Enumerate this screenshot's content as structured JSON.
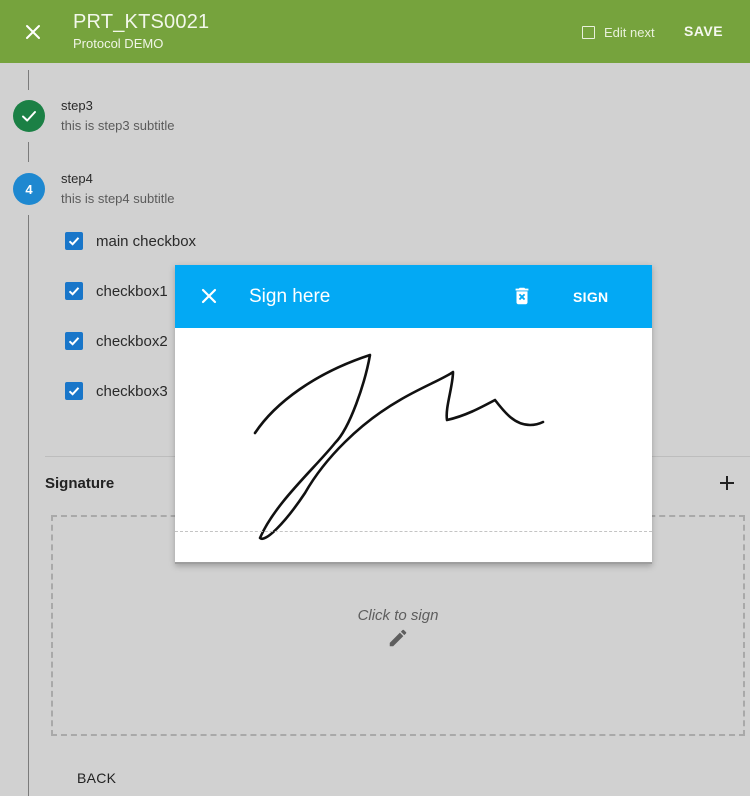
{
  "header": {
    "title": "PRT_KTS0021",
    "subtitle": "Protocol DEMO",
    "edit_next_label": "Edit next",
    "save_label": "SAVE",
    "bg_color": "#76a33d"
  },
  "steps": [
    {
      "title": "step3",
      "subtitle": "this is step3 subtitle",
      "status": "done",
      "icon": "check-icon",
      "color": "#1b8045"
    },
    {
      "number": "4",
      "title": "step4",
      "subtitle": "this is step4 subtitle",
      "status": "active",
      "color": "#1e88d0"
    }
  ],
  "checkboxes": [
    {
      "label": "main checkbox",
      "checked": true
    },
    {
      "label": "checkbox1",
      "checked": true
    },
    {
      "label": "checkbox2",
      "checked": true
    },
    {
      "label": "checkbox3",
      "checked": true
    }
  ],
  "signature": {
    "title": "Signature",
    "hint": "Click to sign",
    "add_icon": "plus-icon",
    "edit_icon": "pencil-icon"
  },
  "back_label": "BACK",
  "dialog": {
    "title": "Sign here",
    "sign_label": "SIGN",
    "close_icon": "close-icon",
    "delete_icon": "trash-icon",
    "bar_color": "#03a9f4"
  }
}
